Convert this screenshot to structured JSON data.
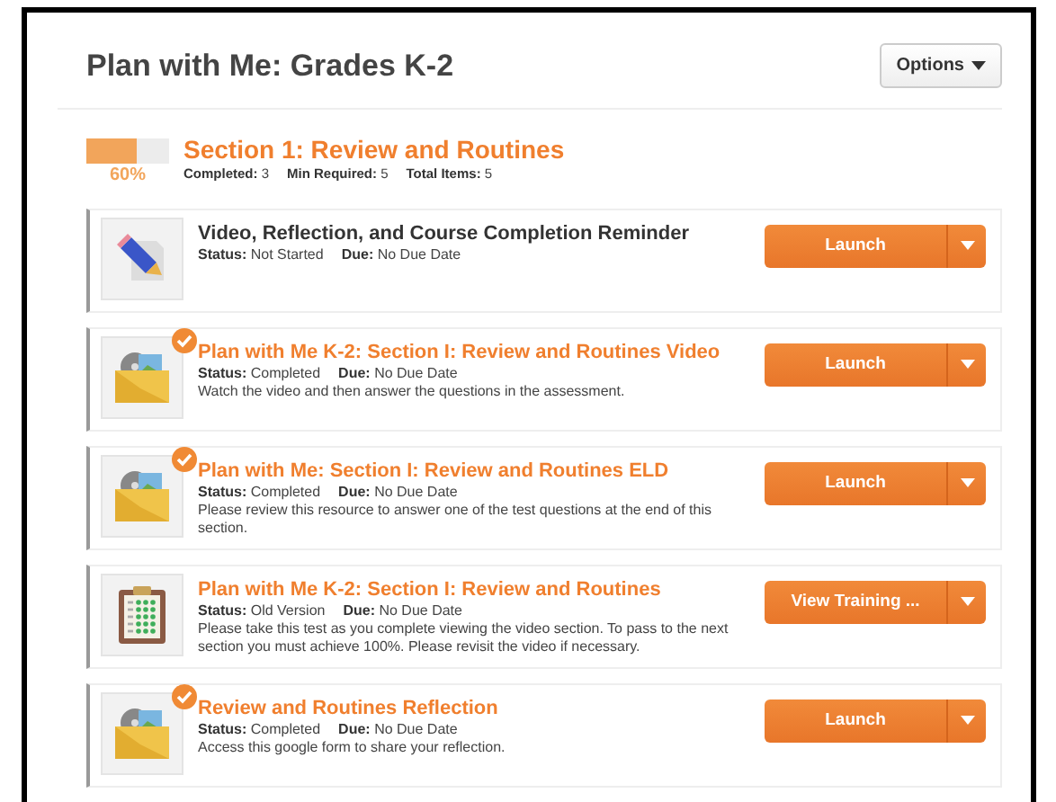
{
  "page": {
    "title": "Plan with Me: Grades K-2",
    "options_button": "Options"
  },
  "section": {
    "title": "Section 1: Review and Routines",
    "level": 0.6,
    "percent": "60%",
    "stats": [
      {
        "label": "Completed:",
        "value": "3"
      },
      {
        "label": "Min Required:",
        "value": "5"
      },
      {
        "label": "Total Items:",
        "value": "5"
      }
    ]
  },
  "items": [
    {
      "kind": "assignment",
      "title": "Video, Reflection, and Course Completion Reminder",
      "visited": false,
      "checked": false,
      "status_label": "Status:",
      "status": "Not Started",
      "due_label": "Due:",
      "due": "No Due Date",
      "button": "Launch"
    },
    {
      "kind": "media",
      "title": "Plan with Me K-2: Section I: Review and Routines Video",
      "visited": true,
      "checked": true,
      "status_label": "Status:",
      "status": "Completed",
      "due_label": "Due:",
      "due": "No Due Date",
      "description": "Watch the video and then answer the questions in the assessment.",
      "button": "Launch"
    },
    {
      "kind": "media",
      "title": "Plan with Me: Section I: Review and Routines ELD",
      "visited": true,
      "checked": true,
      "status_label": "Status:",
      "status": "Completed",
      "due_label": "Due:",
      "due": "No Due Date",
      "description": "Please review this resource to answer one of the test questions at the end of this section.",
      "button": "Launch"
    },
    {
      "kind": "test",
      "title": "Plan with Me K-2: Section I: Review and Routines",
      "visited": true,
      "checked": false,
      "status_label": "Status:",
      "status": "Old Version",
      "due_label": "Due:",
      "due": "No Due Date",
      "description": "Please take this test as you complete viewing the video section. To pass to the next section you must achieve 100%. Please revisit the video if necessary.",
      "button": "View Training ..."
    },
    {
      "kind": "media",
      "title": "Review and Routines Reflection",
      "visited": true,
      "checked": true,
      "status_label": "Status:",
      "status": "Completed",
      "due_label": "Due:",
      "due": "No Due Date",
      "description": "Access this google form to share your reflection.",
      "button": "Launch"
    }
  ]
}
